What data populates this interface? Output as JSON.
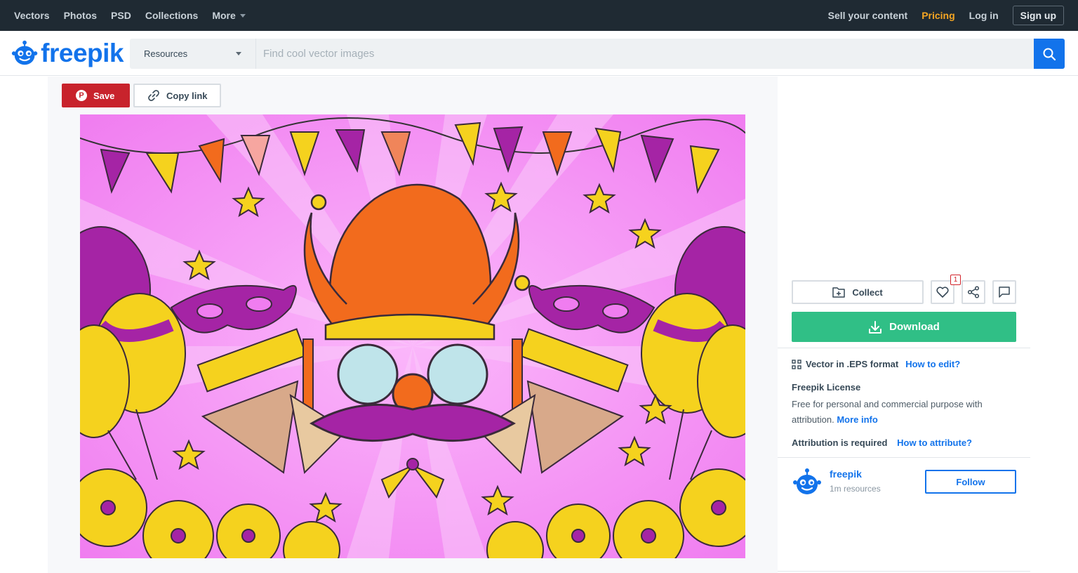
{
  "topnav": {
    "items": [
      "Vectors",
      "Photos",
      "PSD",
      "Collections"
    ],
    "more_label": "More",
    "sell_label": "Sell your content",
    "pricing_label": "Pricing",
    "login_label": "Log in",
    "signup_label": "Sign up"
  },
  "header": {
    "logo_text": "freepik",
    "resources_label": "Resources",
    "search_placeholder": "Find cool vector images"
  },
  "actions": {
    "save_label": "Save",
    "copy_link_label": "Copy link"
  },
  "side": {
    "collect_label": "Collect",
    "like_count": "1",
    "download_label": "Download",
    "format_label": "Vector in .EPS format",
    "how_to_edit": "How to edit?",
    "license_title": "Freepik License",
    "license_text": "Free for personal and commercial purpose with attribution.",
    "more_info": "More info",
    "attribution_label": "Attribution is required",
    "how_to_attribute": "How to attribute?",
    "author_name": "freepik",
    "author_resources": "1m resources",
    "follow_label": "Follow"
  },
  "colors": {
    "nav_bg": "#1f2a33",
    "brand_blue": "#1273eb",
    "pricing_orange": "#f5a623",
    "save_red": "#c8232c",
    "download_green": "#30bf86",
    "preview_pink": "#f07df0"
  },
  "icons": {
    "search": "magnifier-icon",
    "pinterest": "pinterest-icon",
    "link": "link-icon",
    "collect": "folder-plus-icon",
    "like": "heart-icon",
    "share": "share-icon",
    "comment": "comment-icon",
    "download": "download-icon",
    "format": "vector-format-icon"
  }
}
